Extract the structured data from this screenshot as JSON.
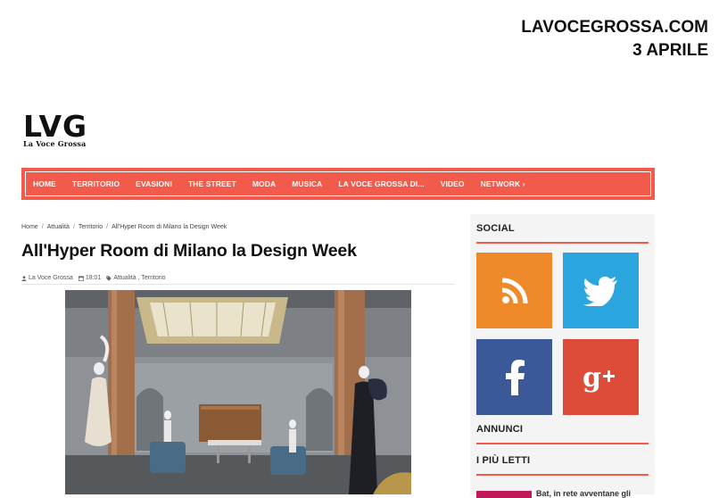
{
  "stamp": {
    "site": "LAVOCEGROSSA.COM",
    "date": "3 APRILE"
  },
  "logo": {
    "main": "LVG",
    "sub": "La Voce Grossa"
  },
  "nav": {
    "items": [
      {
        "label": "HOME"
      },
      {
        "label": "TERRITORIO"
      },
      {
        "label": "EVASIONI"
      },
      {
        "label": "THE STREET"
      },
      {
        "label": "MODA"
      },
      {
        "label": "MUSICA"
      },
      {
        "label": "LA VOCE GROSSA DI..."
      },
      {
        "label": "VIDEO"
      },
      {
        "label": "NETWORK ›"
      }
    ]
  },
  "breadcrumb": [
    {
      "label": "Home"
    },
    {
      "label": "Attualità"
    },
    {
      "label": "Territorio"
    },
    {
      "label": "All'Hyper Room di Milano la Design Week"
    }
  ],
  "article": {
    "title": "All'Hyper Room di Milano la Design Week",
    "author": "La Voce Grossa",
    "time": "18:01",
    "categories": "Attualità , Territorio"
  },
  "sidebar": {
    "social_title": "SOCIAL",
    "ads_title": "ANNUNCI",
    "popular_title": "I PIÙ LETTI",
    "popular_snippet": "Bat, in rete avventane gli",
    "social": [
      {
        "name": "rss",
        "icon": "rss-icon",
        "color": "#ee8a2a"
      },
      {
        "name": "twitter",
        "icon": "twitter-icon",
        "color": "#2aa5dd"
      },
      {
        "name": "facebook",
        "icon": "facebook-icon",
        "color": "#3b5998"
      },
      {
        "name": "google-plus",
        "icon": "google-plus-icon",
        "color": "#dd4b39"
      }
    ]
  },
  "colors": {
    "accent": "#f25a4c",
    "sidebar_bg": "#f4f4f4"
  }
}
